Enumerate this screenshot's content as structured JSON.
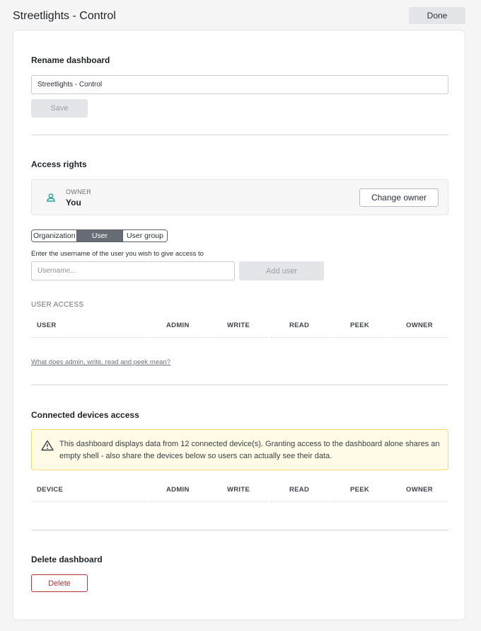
{
  "header": {
    "title": "Streetlights - Control",
    "done_label": "Done"
  },
  "rename": {
    "title": "Rename dashboard",
    "value": "Streetlights - Control",
    "save_label": "Save"
  },
  "access": {
    "title": "Access rights",
    "owner_label": "OWNER",
    "owner_name": "You",
    "change_owner_label": "Change owner",
    "tabs": [
      "Organization",
      "User",
      "User group"
    ],
    "active_tab": "User",
    "help": "Enter the username of the user you wish to give access to",
    "username_placeholder": "Username...",
    "add_user_label": "Add user",
    "user_access_label": "USER ACCESS",
    "user_columns": [
      "USER",
      "ADMIN",
      "WRITE",
      "READ",
      "PEEK",
      "OWNER"
    ],
    "help_link": "What does admin, write, read and peek mean?"
  },
  "devices": {
    "title": "Connected devices access",
    "warning": "This dashboard displays data from 12 connected device(s). Granting access to the dashboard alone shares an empty shell - also share the devices below so users can actually see their data.",
    "columns": [
      "DEVICE",
      "ADMIN",
      "WRITE",
      "READ",
      "PEEK",
      "OWNER"
    ]
  },
  "delete": {
    "title": "Delete dashboard",
    "button_label": "Delete"
  },
  "colors": {
    "accent_teal": "#2aa198",
    "danger": "#b1353b",
    "warning_bg": "#fffbe6",
    "warning_border": "#f2dc6a"
  }
}
